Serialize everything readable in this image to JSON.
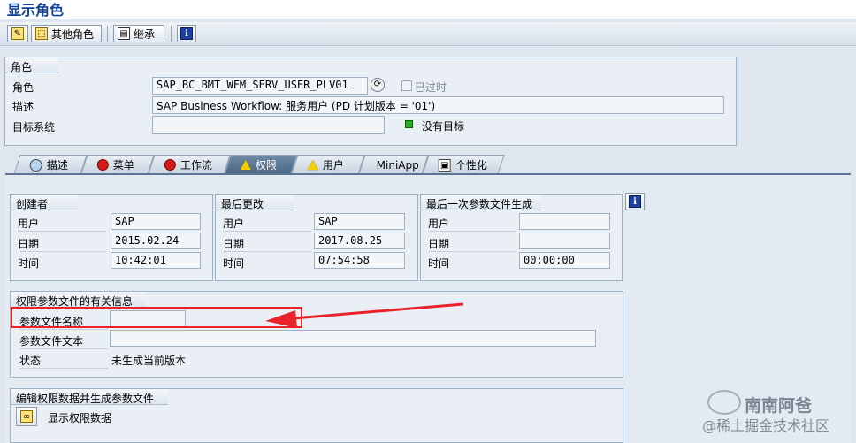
{
  "window": {
    "title": "显示角色"
  },
  "toolbar": {
    "other_role_label": "其他角色",
    "inherit_label": "继承"
  },
  "role_group": {
    "title": "角色",
    "role_label": "角色",
    "role_value": "SAP_BC_BMT_WFM_SERV_USER_PLV01",
    "expired_label": "已过时",
    "desc_label": "描述",
    "desc_value": "SAP Business Workflow: 服务用户 (PD 计划版本 = '01')",
    "target_label": "目标系统",
    "target_value": "",
    "status_text": "没有目标",
    "status_color": "#22b022"
  },
  "tabs": [
    {
      "label": "描述"
    },
    {
      "label": "菜单"
    },
    {
      "label": "工作流"
    },
    {
      "label": "权限"
    },
    {
      "label": "用户"
    },
    {
      "label": "MiniApp"
    },
    {
      "label": "个性化"
    }
  ],
  "created": {
    "title": "创建者",
    "user_label": "用户",
    "user": "SAP",
    "date_label": "日期",
    "date": "2015.02.24",
    "time_label": "时间",
    "time": "10:42:01"
  },
  "changed": {
    "title": "最后更改",
    "user_label": "用户",
    "user": "SAP",
    "date_label": "日期",
    "date": "2017.08.25",
    "time_label": "时间",
    "time": "07:54:58"
  },
  "generated": {
    "title": "最后一次参数文件生成",
    "user_label": "用户",
    "user": "",
    "date_label": "日期",
    "date": "",
    "time_label": "时间",
    "time": "00:00:00"
  },
  "profile": {
    "title": "权限参数文件的有关信息",
    "name_label": "参数文件名称",
    "name_value": "",
    "text_label": "参数文件文本",
    "text_value": "",
    "status_label": "状态",
    "status_value": "未生成当前版本"
  },
  "edit": {
    "title": "编辑权限数据并生成参数文件",
    "show_label": "显示权限数据"
  },
  "watermark": {
    "line1": "南南阿爸",
    "line2": "@稀土掘金技术社区"
  },
  "colors": {
    "accent": "#15409a",
    "annotation": "#e8232a"
  }
}
